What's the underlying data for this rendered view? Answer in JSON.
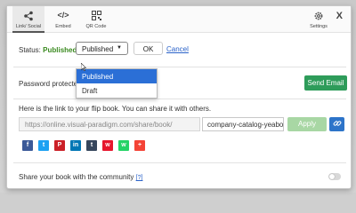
{
  "tabs": [
    {
      "label": "Link/ Social",
      "icon": "share-icon",
      "active": true
    },
    {
      "label": "Embed",
      "icon": "code-icon",
      "active": false
    },
    {
      "label": "QR Code",
      "icon": "qr-code-icon",
      "active": false
    }
  ],
  "settings": {
    "label": "Settings",
    "icon": "gear-icon"
  },
  "close": {
    "label": "X"
  },
  "status": {
    "label": "Status:",
    "value": "Published",
    "select_value": "Published",
    "options": [
      "Published",
      "Draft"
    ],
    "ok_label": "OK",
    "cancel_label": "Cancel"
  },
  "password": {
    "label": "Password protecte"
  },
  "send_email": {
    "label": "Send Email"
  },
  "share_link": {
    "text": "Here is the link to your flip book. You can share it with others.",
    "url": "https://online.visual-paradigm.com/share/book/",
    "slug": "company-catalog-yeaboc",
    "apply_label": "Apply",
    "link_icon": "link-icon"
  },
  "social": [
    {
      "name": "facebook-icon",
      "glyph": "f",
      "color": "#3b5998"
    },
    {
      "name": "twitter-icon",
      "glyph": "t",
      "color": "#1da1f2"
    },
    {
      "name": "pinterest-icon",
      "glyph": "P",
      "color": "#cb2027"
    },
    {
      "name": "linkedin-icon",
      "glyph": "in",
      "color": "#0077b5"
    },
    {
      "name": "tumblr-icon",
      "glyph": "t",
      "color": "#35465c"
    },
    {
      "name": "weibo-icon",
      "glyph": "w",
      "color": "#e6162d"
    },
    {
      "name": "whatsapp-icon",
      "glyph": "w",
      "color": "#25d366"
    },
    {
      "name": "more-plus-icon",
      "glyph": "+",
      "color": "#f44336"
    }
  ],
  "community": {
    "label": "Share your book with the community",
    "help": "[?]",
    "toggle_on": false
  },
  "colors": {
    "published": "#3a8a1f",
    "send_email": "#2e9c5a",
    "apply": "#a8d7a4",
    "link_button": "#2d74c9",
    "selected_option": "#2b6fd6"
  }
}
